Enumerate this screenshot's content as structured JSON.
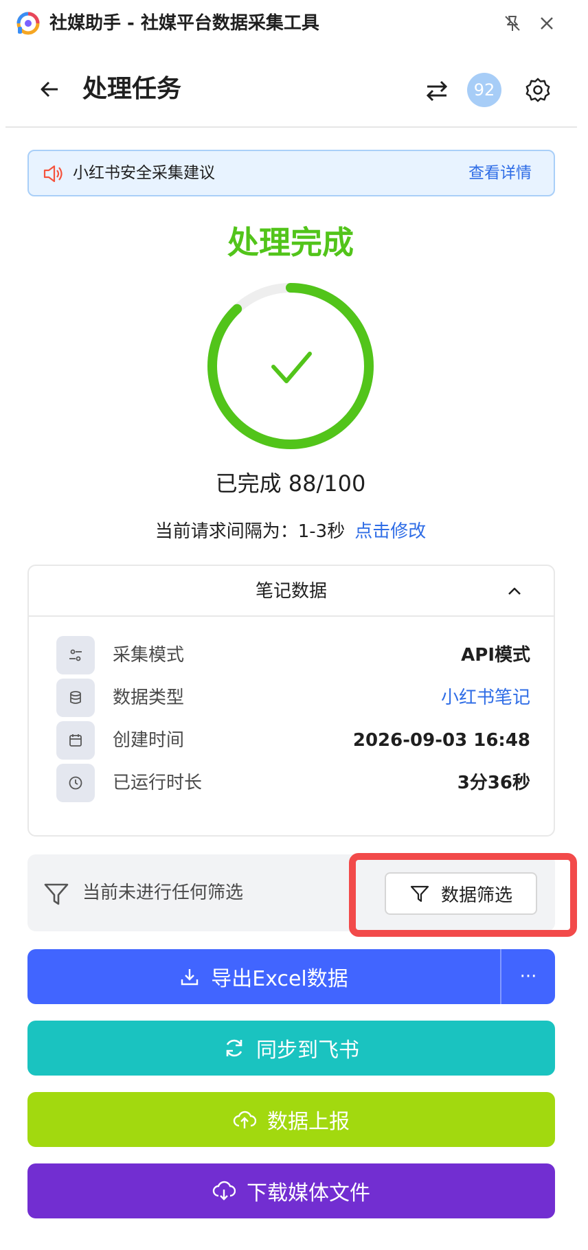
{
  "app": {
    "title": "社媒助手 - 社媒平台数据采集工具"
  },
  "header": {
    "title": "处理任务",
    "badge": "92"
  },
  "notice": {
    "text": "小红书安全采集建议",
    "link": "查看详情"
  },
  "status": {
    "title": "处理完成",
    "progress_text": "已完成 88/100",
    "progress_fraction": 0.88,
    "interval_label": "当前请求间隔为：1-3秒",
    "interval_link": "点击修改"
  },
  "card": {
    "title": "笔记数据",
    "rows": [
      {
        "label": "采集模式",
        "value": "API模式",
        "icon": "sliders-icon"
      },
      {
        "label": "数据类型",
        "value": "小红书笔记",
        "icon": "database-icon"
      },
      {
        "label": "创建时间",
        "value": "2026-09-03 16:48",
        "icon": "calendar-icon"
      },
      {
        "label": "已运行时长",
        "value": "3分36秒",
        "icon": "clock-icon"
      }
    ]
  },
  "filter": {
    "status_text": "当前未进行任何筛选",
    "button_label": "数据筛选"
  },
  "actions": {
    "export_label": "导出Excel数据",
    "export_more": "···",
    "sync_label": "同步到飞书",
    "report_label": "数据上报",
    "download_label": "下载媒体文件"
  },
  "colors": {
    "success": "#52c41a",
    "link": "#2f6de6",
    "export": "#4165ff",
    "sync": "#1ac3c0",
    "report": "#a2d90f",
    "download": "#722ed1",
    "highlight": "#f24a4a"
  }
}
